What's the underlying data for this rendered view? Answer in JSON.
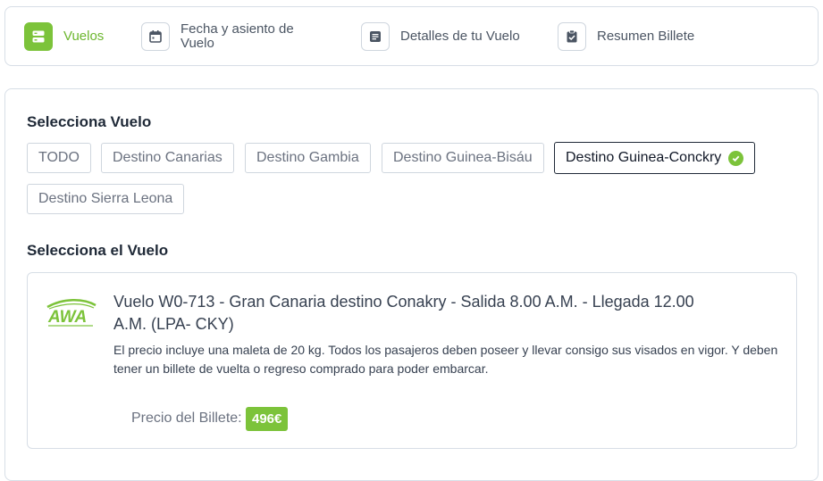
{
  "steps": [
    {
      "label": "Vuelos",
      "icon": "flights-icon"
    },
    {
      "label": "Fecha y asiento de Vuelo",
      "icon": "calendar-icon"
    },
    {
      "label": "Detalles de tu Vuelo",
      "icon": "document-icon"
    },
    {
      "label": "Resumen Billete",
      "icon": "clipboard-check-icon"
    }
  ],
  "select_flight": {
    "heading": "Selecciona Vuelo",
    "destinations": [
      "TODO",
      "Destino Canarias",
      "Destino Gambia",
      "Destino Guinea-Bisáu",
      "Destino Guinea-Conckry",
      "Destino Sierra Leona"
    ],
    "selected": "Destino Guinea-Conckry"
  },
  "select_the_flight": {
    "heading": "Selecciona el Vuelo"
  },
  "flight": {
    "airline_logo_text": "AWA",
    "title": "Vuelo W0-713 - Gran Canaria destino Conakry - Salida 8.00 A.M. - Llegada 12.00 A.M. (LPA- CKY)",
    "description": "El precio incluye una maleta de 20 kg. Todos los pasajeros deben poseer y llevar consigo sus visados en vigor. Y deben tener un billete de vuelta o regreso comprado para poder embarcar.",
    "price_label": "Precio del Billete:",
    "price": "496€"
  },
  "colors": {
    "accent": "#7cc33a",
    "accent_text": "#6cb62e",
    "border": "#d7dee6"
  }
}
